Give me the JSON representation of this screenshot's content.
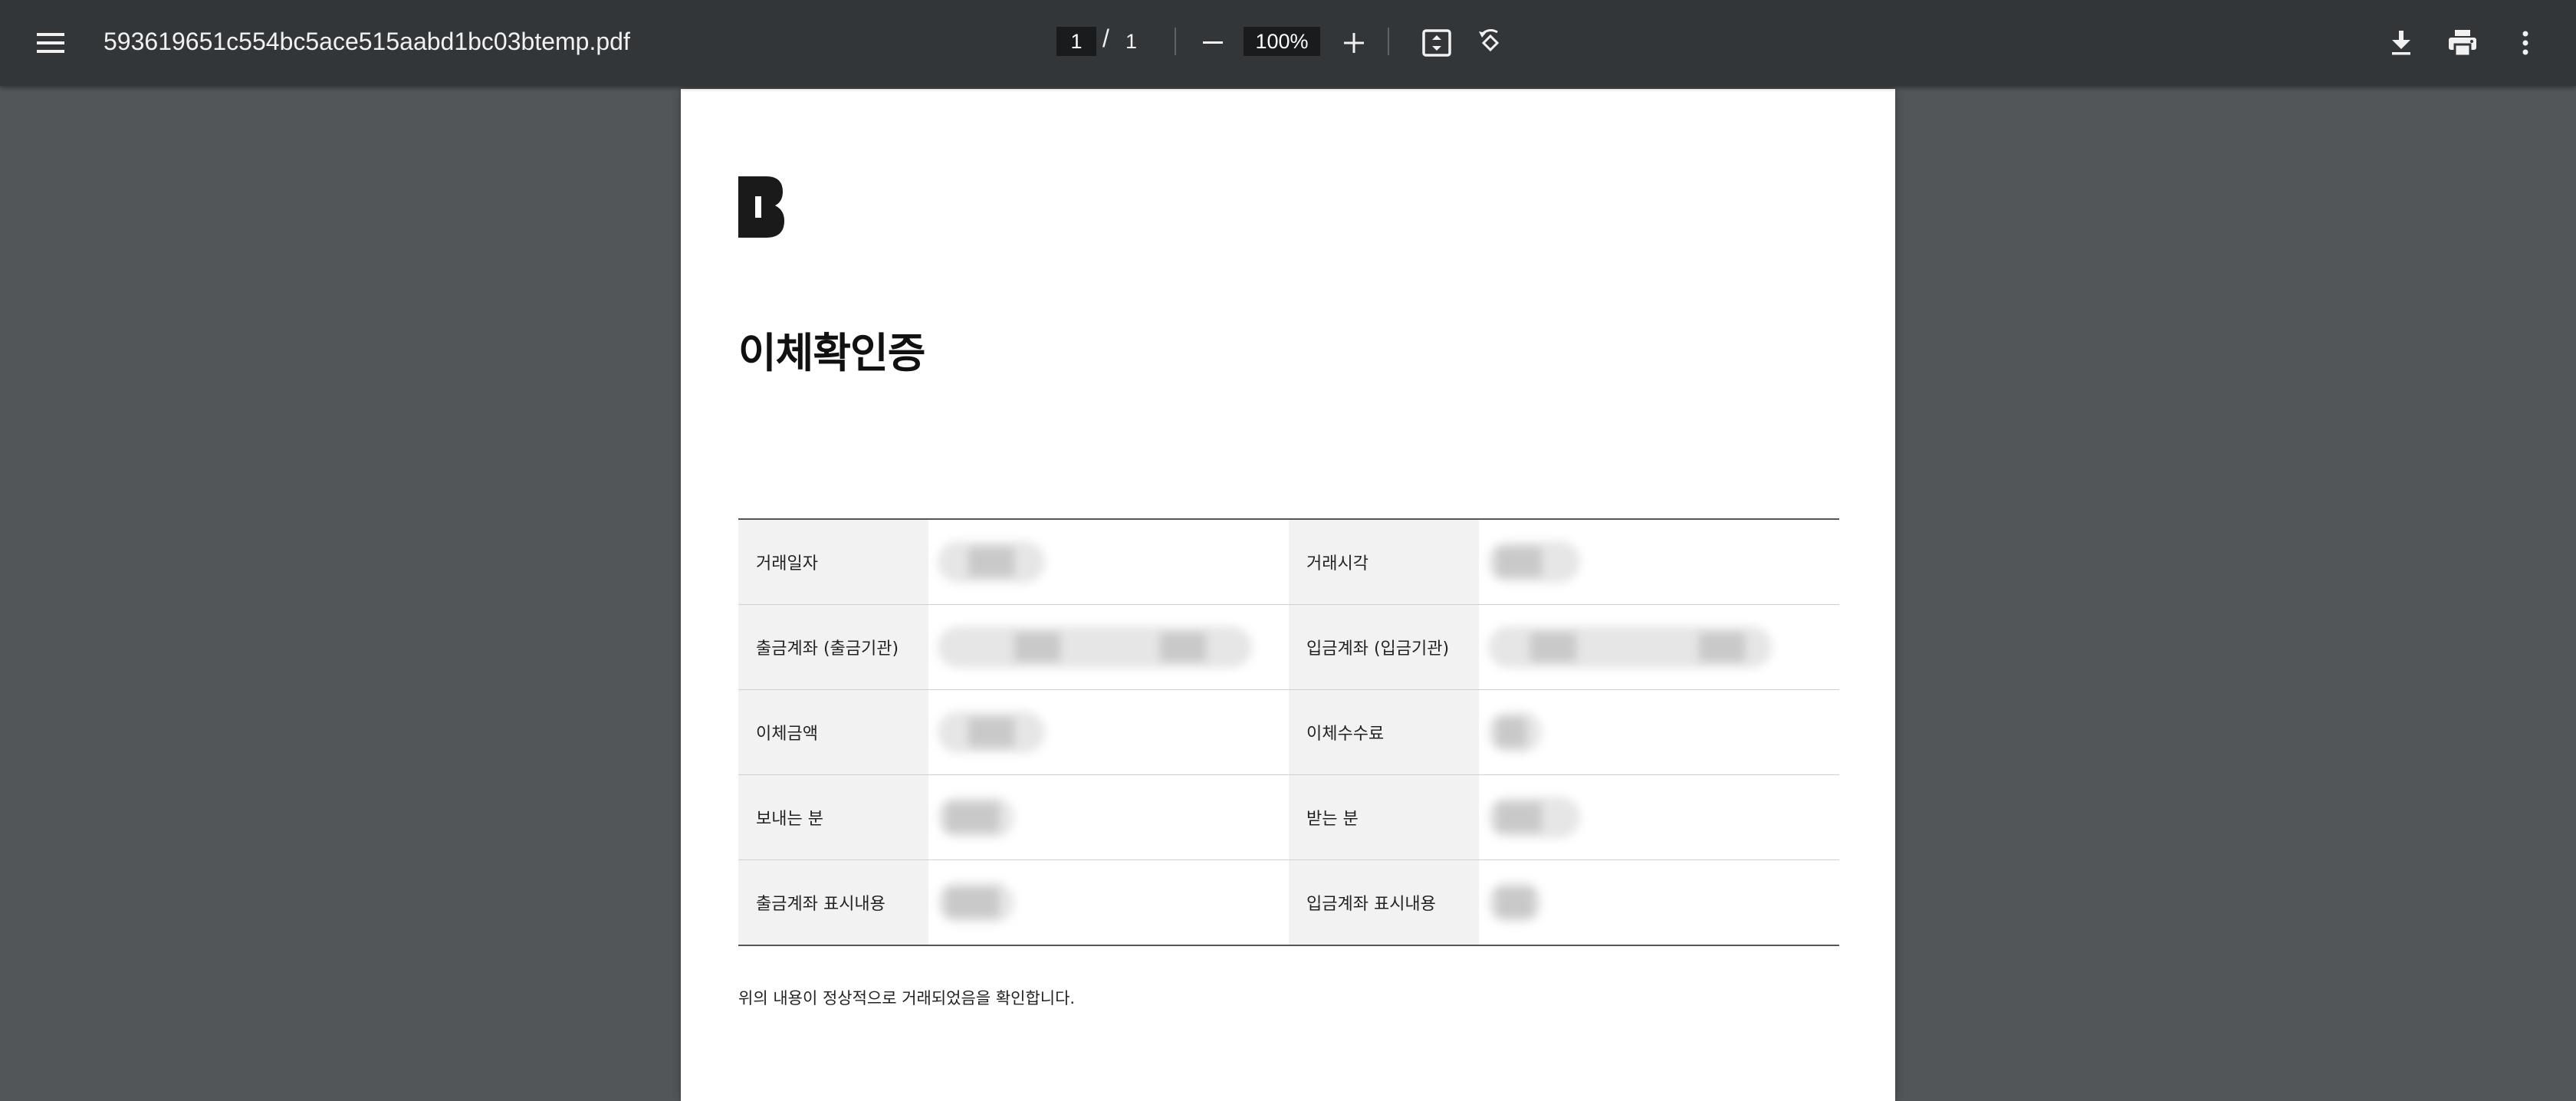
{
  "toolbar": {
    "file_name": "593619651c554bc5ace515aabd1bc03btemp.pdf",
    "current_page": "1",
    "page_separator": "/",
    "total_pages": "1",
    "zoom": "100%",
    "icons": [
      "menu-icon",
      "zoom-out-icon",
      "zoom-in-icon",
      "fit-page-icon",
      "rotate-icon",
      "download-icon",
      "print-icon",
      "more-vert-icon"
    ]
  },
  "document": {
    "title": "이체확인증",
    "rows": [
      {
        "left_label": "거래일자",
        "right_label": "거래시각"
      },
      {
        "left_label": "출금계좌 (출금기관)",
        "right_label": "입금계좌 (입금기관)"
      },
      {
        "left_label": "이체금액",
        "right_label": "이체수수료"
      },
      {
        "left_label": "보내는 분",
        "right_label": "받는 분"
      },
      {
        "left_label": "출금계좌 표시내용",
        "right_label": "입금계좌 표시내용"
      }
    ],
    "footnote": "위의 내용이 정상적으로 거래되었음을 확인합니다."
  },
  "colors": {
    "toolbar_bg": "#323639",
    "viewer_bg": "#525659",
    "page_bg": "#ffffff",
    "label_bg": "#f2f2f2"
  }
}
